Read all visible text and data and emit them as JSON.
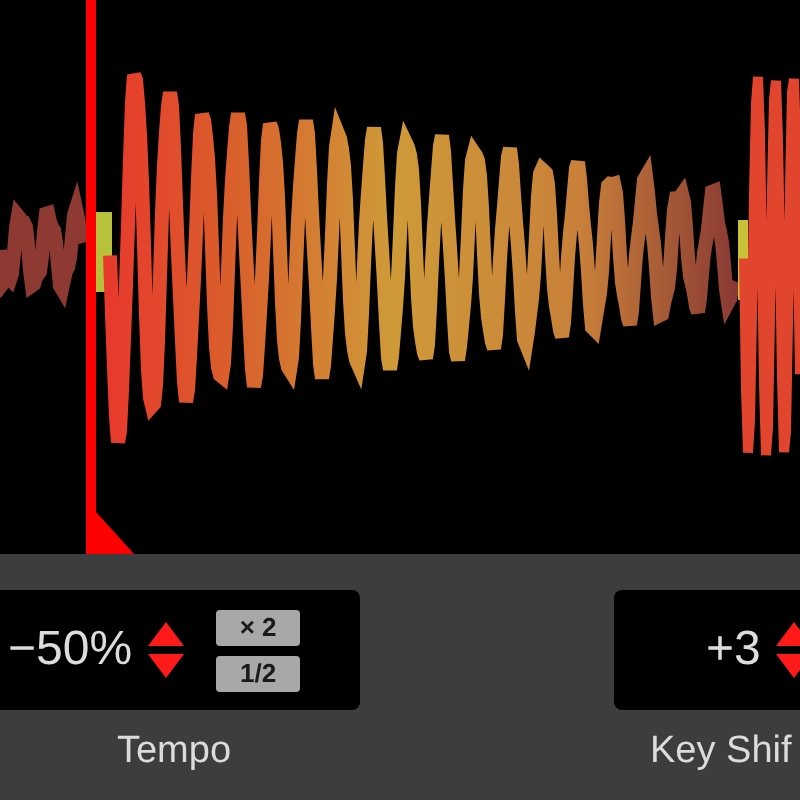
{
  "tempo": {
    "value": "−50%",
    "buttons": [
      "× 2",
      "1/2"
    ],
    "label": "Tempo"
  },
  "key_shift": {
    "value": "+3",
    "label": "Key Shif"
  }
}
